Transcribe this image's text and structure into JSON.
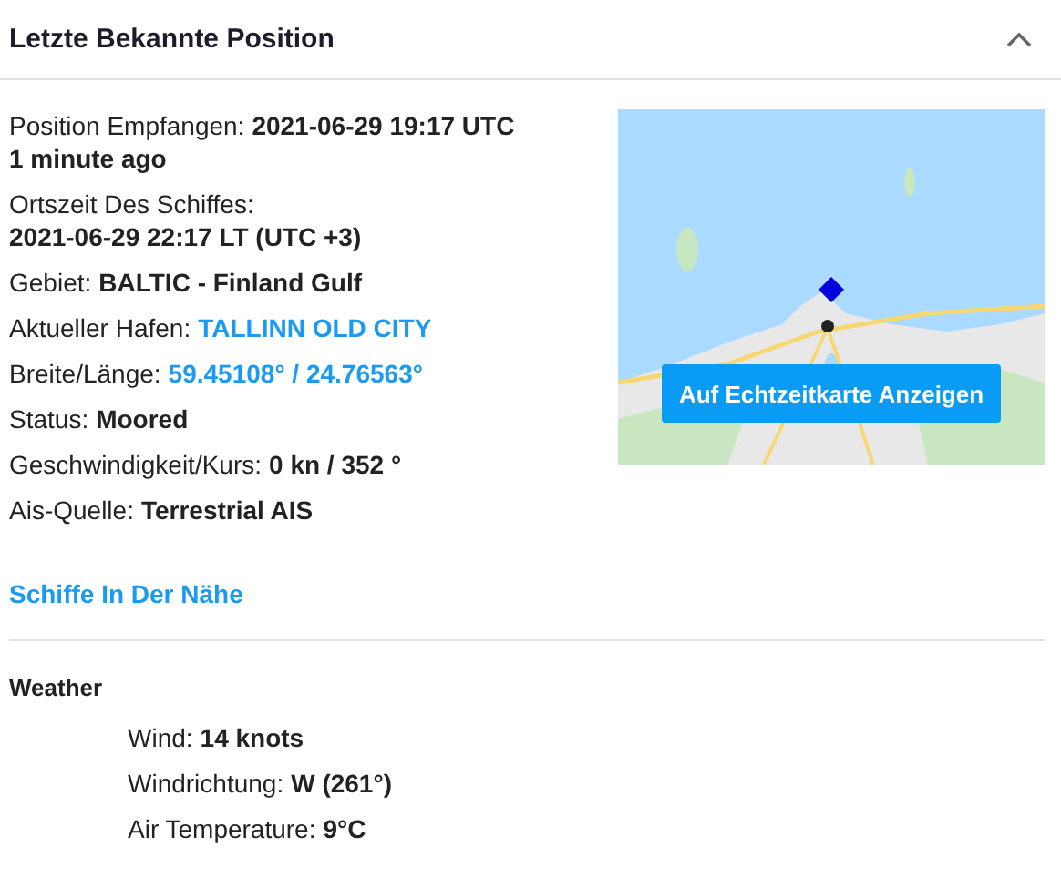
{
  "panel": {
    "title": "Letzte Bekannte Position",
    "expanded": true
  },
  "details": [
    {
      "label": "Position Empfangen:",
      "value": "2021-06-29 19:17 UTC",
      "kind": "bold",
      "value_on_new_line": false,
      "note": "1 minute ago"
    },
    {
      "label": "Ortszeit Des Schiffes:",
      "value": "2021-06-29 22:17 LT (UTC +3)",
      "kind": "bold",
      "value_on_new_line": true
    },
    {
      "label": "Gebiet:",
      "value": "BALTIC - Finland Gulf",
      "kind": "bold",
      "value_on_new_line": false
    },
    {
      "label": "Aktueller Hafen:",
      "value": "TALLINN OLD CITY",
      "kind": "link",
      "value_on_new_line": false
    },
    {
      "label": "Breite/Länge:",
      "value": "59.45108° / 24.76563°",
      "kind": "link",
      "value_on_new_line": false
    },
    {
      "label": "Status:",
      "value": "Moored",
      "kind": "bold",
      "value_on_new_line": false
    },
    {
      "label": "Geschwindigkeit/Kurs:",
      "value": "0 kn / 352 °",
      "kind": "bold",
      "value_on_new_line": false
    },
    {
      "label": "Ais-Quelle:",
      "value": "Terrestrial AIS",
      "kind": "bold",
      "value_on_new_line": false
    }
  ],
  "map": {
    "kind": "picture",
    "button": "Auf Echtzeitkarte Anzeigen"
  },
  "nearby_link": "Schiffe In Der Nähe",
  "weather": {
    "title": "Weather",
    "items": [
      {
        "label": "Wind:",
        "value": "14 knots"
      },
      {
        "label": "Windrichtung:",
        "value": "W (261°)"
      },
      {
        "label": "Air Temperature:",
        "value": "9°C"
      }
    ]
  }
}
